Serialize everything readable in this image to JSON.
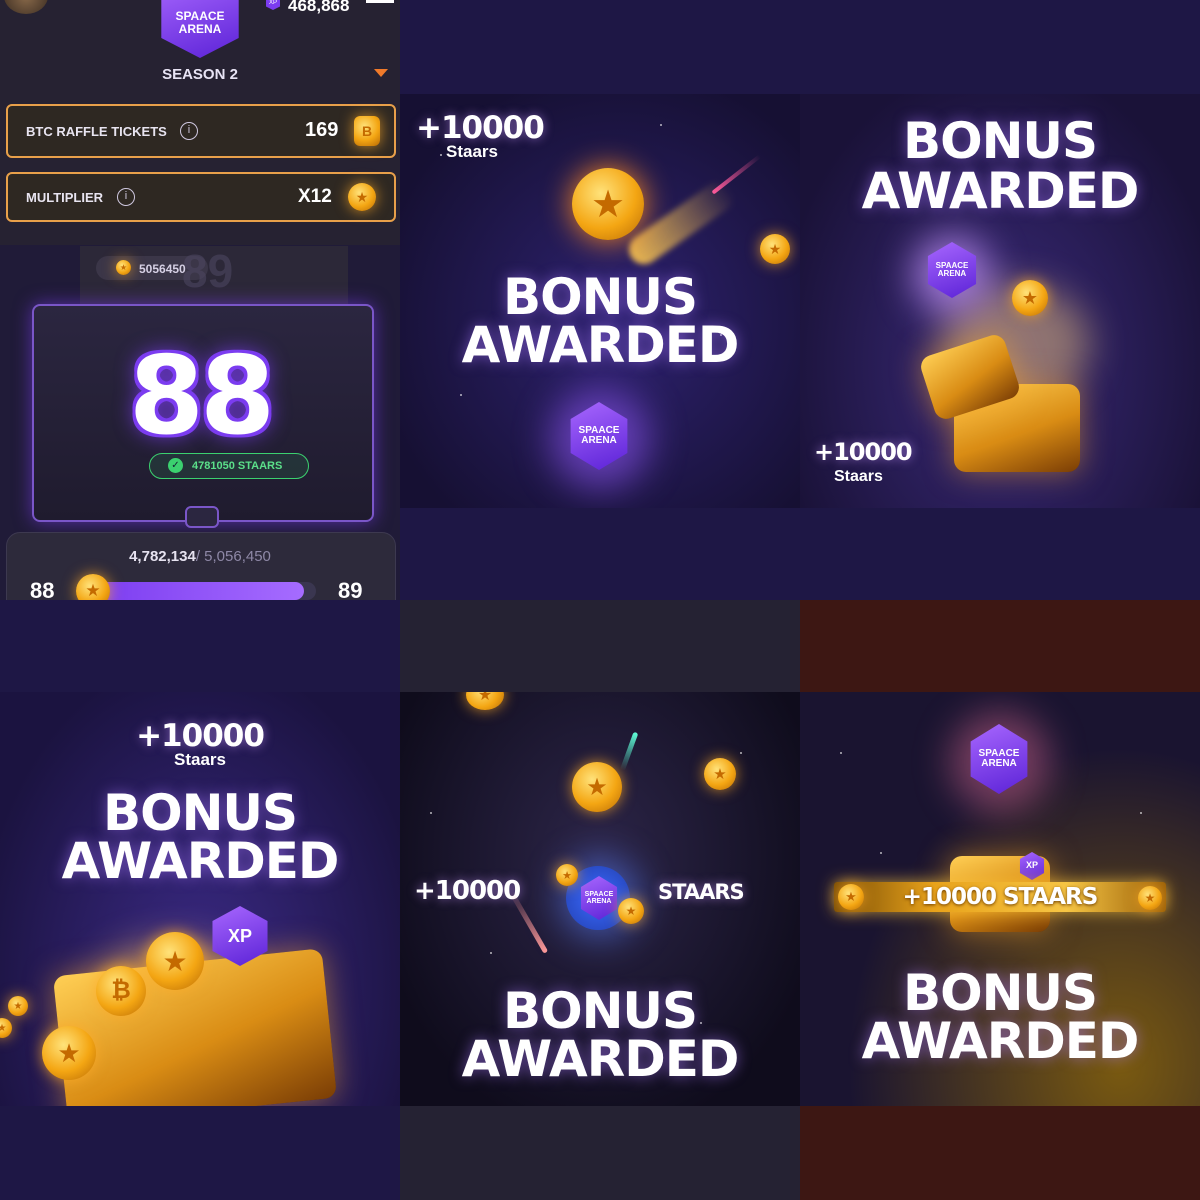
{
  "panel_top_left": {
    "xp_value": "468,868",
    "badge_text": "SPAACE ARENA",
    "season_label": "SEASON 2",
    "btc_label": "BTC RAFFLE TICKETS",
    "btc_value": "169",
    "multiplier_label": "MULTIPLIER",
    "multiplier_value": "X12",
    "staars_pill": "5056450",
    "next_level_ghost": "89",
    "level": "88",
    "earned_pill": "4781050 STAARS",
    "progress_current": "4,782,134",
    "progress_total": "/ 5,056,450",
    "progress_fraction": 0.946,
    "level_left": "88",
    "level_right": "89"
  },
  "tile_2": {
    "amount": "+10000",
    "unit": "Staars",
    "line1": "BONUS",
    "line2": "AWARDED",
    "badge": "SPAACE ARENA"
  },
  "tile_3": {
    "amount": "+10000",
    "unit": "Staars",
    "line1": "BONUS",
    "line2": "AWARDED",
    "badge": "SPAACE ARENA"
  },
  "tile_4": {
    "amount": "+10000",
    "unit": "Staars",
    "line1": "BONUS",
    "line2": "AWARDED",
    "xp_badge": "XP"
  },
  "tile_5": {
    "amount": "+10000",
    "unit": "STAARS",
    "line1": "BONUS",
    "line2": "AWARDED",
    "badge": "SPAACE ARENA"
  },
  "tile_6": {
    "banner": "+10000 STAARS",
    "line1": "BONUS",
    "line2": "AWARDED",
    "badge": "SPAACE ARENA",
    "xp_badge": "XP"
  },
  "colors": {
    "accent_orange": "#e8a04a",
    "purple": "#7b3cf0",
    "green": "#3bd16f",
    "bg_navy": "#1e1745"
  }
}
